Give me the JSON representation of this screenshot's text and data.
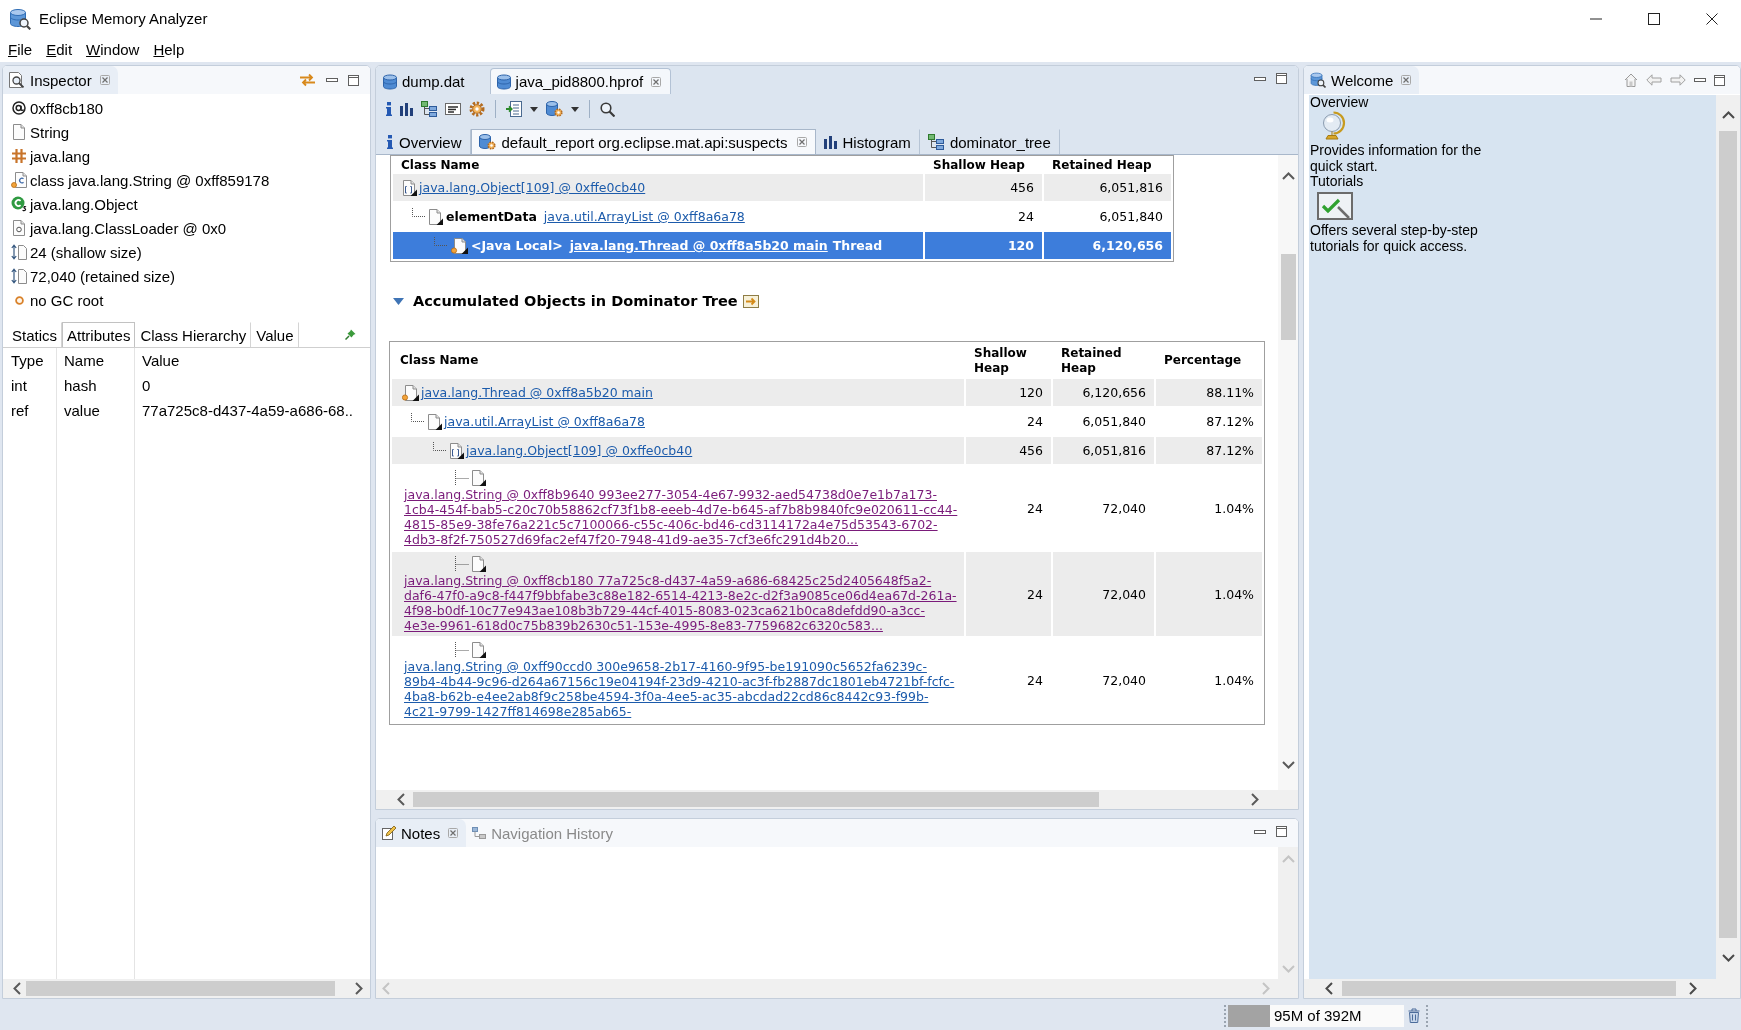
{
  "window": {
    "title": "Eclipse Memory Analyzer"
  },
  "menu": [
    "File",
    "Edit",
    "Window",
    "Help"
  ],
  "inspector": {
    "tab": {
      "label": "Inspector",
      "selected": true
    },
    "items": [
      {
        "kind": "address",
        "text": "0xff8cb180"
      },
      {
        "kind": "type",
        "text": "String"
      },
      {
        "kind": "package",
        "text": "java.lang"
      },
      {
        "kind": "class",
        "text": "class java.lang.String @ 0xff859178"
      },
      {
        "kind": "superclass",
        "text": "java.lang.Object"
      },
      {
        "kind": "class_loader",
        "text": "java.lang.ClassLoader @ 0x0"
      },
      {
        "kind": "size",
        "text": "24 (shallow size)"
      },
      {
        "kind": "size",
        "text": "72,040 (retained size)"
      },
      {
        "kind": "gc_root",
        "text": "no GC root"
      }
    ],
    "tabs": [
      {
        "label": "Statics",
        "selected": false
      },
      {
        "label": "Attributes",
        "selected": true
      },
      {
        "label": "Class Hierarchy",
        "selected": false
      },
      {
        "label": "Value",
        "selected": false
      }
    ],
    "table": {
      "columns": [
        "Type",
        "Name",
        "Value"
      ],
      "rows": [
        [
          "int",
          "hash",
          "0"
        ],
        [
          "ref",
          "value",
          "77a725c8-d437-4a59-a686-68.."
        ]
      ]
    }
  },
  "editor": {
    "tabs": [
      {
        "label": "dump.dat",
        "selected": false
      },
      {
        "label": "java_pid8800.hprof",
        "selected": true
      }
    ],
    "subtabs": [
      {
        "kind": "overview",
        "label": "Overview",
        "selected": false
      },
      {
        "kind": "report",
        "label": "default_report org.eclipse.mat.api:suspects",
        "selected": true
      },
      {
        "kind": "histogram",
        "label": "Histogram",
        "selected": false
      },
      {
        "kind": "dominator_tree",
        "label": "dominator_tree",
        "selected": false
      }
    ],
    "report": {
      "path_table": {
        "columns": [
          "Class Name",
          "Shallow Heap",
          "Retained Heap"
        ],
        "rows": [
          {
            "kind": "array",
            "link": "java.lang.Object[109] @ 0xffe0cb40",
            "shallow_heap": "456",
            "retained_heap": "6,051,816",
            "selected": false,
            "children": [
              {
                "kind": "object",
                "field": "elementData",
                "link": "java.util.ArrayList @ 0xff8a6a78",
                "shallow_heap": "24",
                "retained_heap": "6,051,840",
                "selected": false,
                "children": [
                  {
                    "kind": "gc_root",
                    "field": "<Java Local>",
                    "link": "java.lang.Thread @ 0xff8a5b20 main",
                    "root_type": "Thread",
                    "shallow_heap": "120",
                    "retained_heap": "6,120,656",
                    "selected": true
                  }
                ]
              }
            ]
          }
        ]
      },
      "section": {
        "title": "Accumulated Objects in Dominator Tree",
        "expanded": true,
        "table": {
          "columns": [
            "Class Name",
            "Shallow Heap",
            "Retained Heap",
            "Percentage"
          ],
          "rows": [
            {
              "kind": "gc_root",
              "link": "java.lang.Thread @ 0xff8a5b20 main",
              "visited": false,
              "shallow_heap": "120",
              "retained_heap": "6,120,656",
              "percentage": "88.11%",
              "children": [
                {
                  "kind": "object",
                  "link": "java.util.ArrayList @ 0xff8a6a78",
                  "visited": false,
                  "shallow_heap": "24",
                  "retained_heap": "6,051,840",
                  "percentage": "87.12%",
                  "children": [
                    {
                      "kind": "array",
                      "link": "java.lang.Object[109] @ 0xffe0cb40",
                      "visited": false,
                      "shallow_heap": "456",
                      "retained_heap": "6,051,816",
                      "percentage": "87.12%",
                      "children": [
                        {
                          "kind": "object",
                          "link": "java.lang.String @ 0xff8b9640 993ee277-3054-4e67-9932-aed54738d0e7e1b7a173-1cb4-454f-bab5-c20c70b58862cf73f1b8-eeeb-4d7e-b645-af7b8b9840fc9e020611-cc44-4815-85e9-38fe76a221c5c7100066-c55c-406c-bd46-cd3114172a4e75d53543-6702-4db3-8f2f-750527d69fac2ef47f20-7948-41d9-ae35-7cf3e6fc291d4b20...",
                          "visited": true,
                          "shallow_heap": "24",
                          "retained_heap": "72,040",
                          "percentage": "1.04%"
                        },
                        {
                          "kind": "object",
                          "link": "java.lang.String @ 0xff8cb180 77a725c8-d437-4a59-a686-68425c25d2405648f5a2-daf6-47f0-a9c8-f447f9bbfabe3c88e182-6514-4213-8e2c-d2f3a9085ce06d4ea67d-261a-4f98-b0df-10c77e943ae108b3b729-44cf-4015-8083-023ca621b0ca8defdd90-a3cc-4e3e-9961-618d0c75b839b2630c51-153e-4995-8e83-7759682c6320c583...",
                          "visited": true,
                          "shallow_heap": "24",
                          "retained_heap": "72,040",
                          "percentage": "1.04%"
                        },
                        {
                          "kind": "object",
                          "link": "java.lang.String @ 0xff90ccd0 300e9658-2b17-4160-9f95-be191090c5652fa6239c-89b4-4b44-9c96-d264a67156c19e04194f-23d9-4210-ac3f-fb2887dc1801eb4721bf-fcfc-4ba8-b62b-e4ee2ab8f9c258be4594-3f0a-4ee5-ac35-abcdad22cd86c8442c93-f99b-4c21-9799-1427ff814698e285ab65-",
                          "visited": false,
                          "shallow_heap": "24",
                          "retained_heap": "72,040",
                          "percentage": "1.04%"
                        }
                      ]
                    }
                  ]
                }
              ]
            }
          ]
        }
      }
    }
  },
  "welcome": {
    "tab": {
      "label": "Welcome",
      "selected": true
    },
    "items": [
      {
        "kind": "overview",
        "heading": "Overview",
        "description": "Provides information for the quick start."
      },
      {
        "kind": "tutorials",
        "heading": "Tutorials",
        "description": "Offers several step-by-step tutorials for quick access."
      }
    ]
  },
  "notes": {
    "tabs": [
      {
        "kind": "notes",
        "label": "Notes",
        "selected": true
      },
      {
        "kind": "history",
        "label": "Navigation History",
        "selected": false
      }
    ]
  },
  "status_bar": {
    "heap": {
      "text": "95M of 392M",
      "level": 0.24
    }
  }
}
